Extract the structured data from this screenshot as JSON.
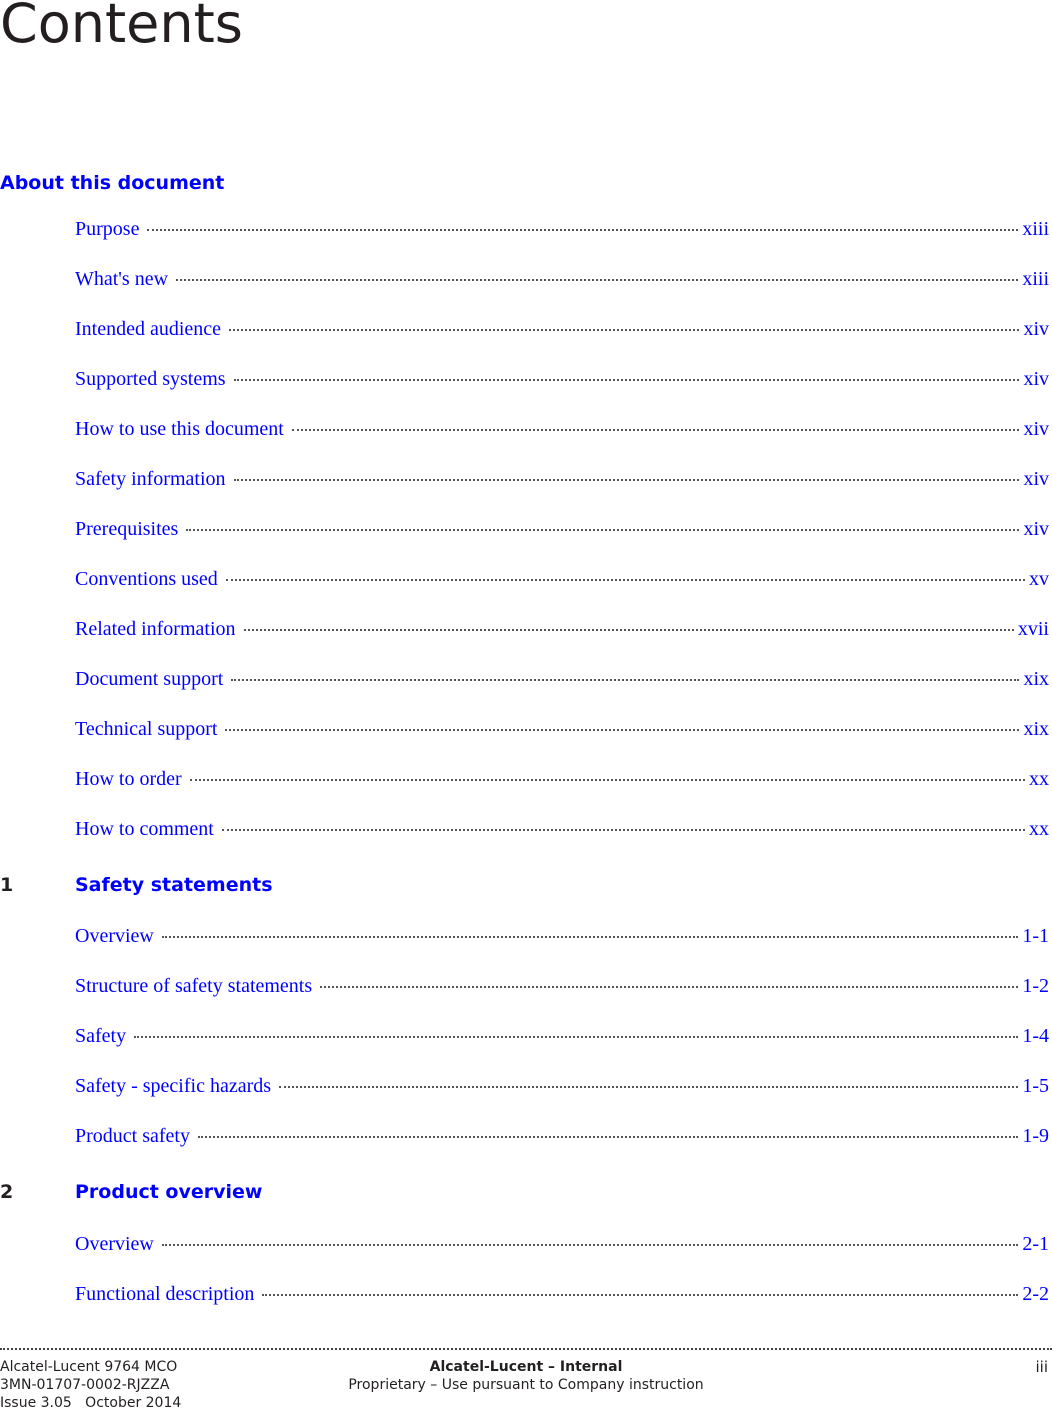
{
  "title": "Contents",
  "sections": [
    {
      "number": "",
      "heading": "About this document",
      "entries": [
        {
          "label": "Purpose",
          "page": "xiii"
        },
        {
          "label": "What's new",
          "page": "xiii"
        },
        {
          "label": "Intended audience",
          "page": "xiv"
        },
        {
          "label": "Supported systems",
          "page": "xiv"
        },
        {
          "label": "How to use this document",
          "page": "xiv"
        },
        {
          "label": "Safety information",
          "page": "xiv"
        },
        {
          "label": "Prerequisites",
          "page": "xiv"
        },
        {
          "label": "Conventions used",
          "page": "xv"
        },
        {
          "label": "Related information",
          "page": "xvii"
        },
        {
          "label": "Document support",
          "page": "xix"
        },
        {
          "label": "Technical support",
          "page": "xix"
        },
        {
          "label": "How to order",
          "page": "xx"
        },
        {
          "label": "How to comment",
          "page": "xx"
        }
      ]
    },
    {
      "number": "1",
      "heading": "Safety statements",
      "entries": [
        {
          "label": "Overview",
          "page": "1-1"
        },
        {
          "label": "Structure of safety statements",
          "page": "1-2"
        },
        {
          "label": "Safety",
          "page": "1-4"
        },
        {
          "label": "Safety - specific hazards",
          "page": "1-5"
        },
        {
          "label": "Product safety",
          "page": "1-9"
        }
      ]
    },
    {
      "number": "2",
      "heading": "Product overview",
      "entries": [
        {
          "label": "Overview",
          "page": "2-1"
        },
        {
          "label": "Functional description",
          "page": "2-2"
        }
      ]
    }
  ],
  "footer": {
    "product": "Alcatel-Lucent 9764 MCO",
    "doc_number": "3MN-01707-0002-RJZZA",
    "issue": "Issue 3.05   October 2014",
    "classification": "Alcatel-Lucent – Internal",
    "notice": "Proprietary – Use pursuant to Company instruction",
    "page_number": "iii"
  }
}
